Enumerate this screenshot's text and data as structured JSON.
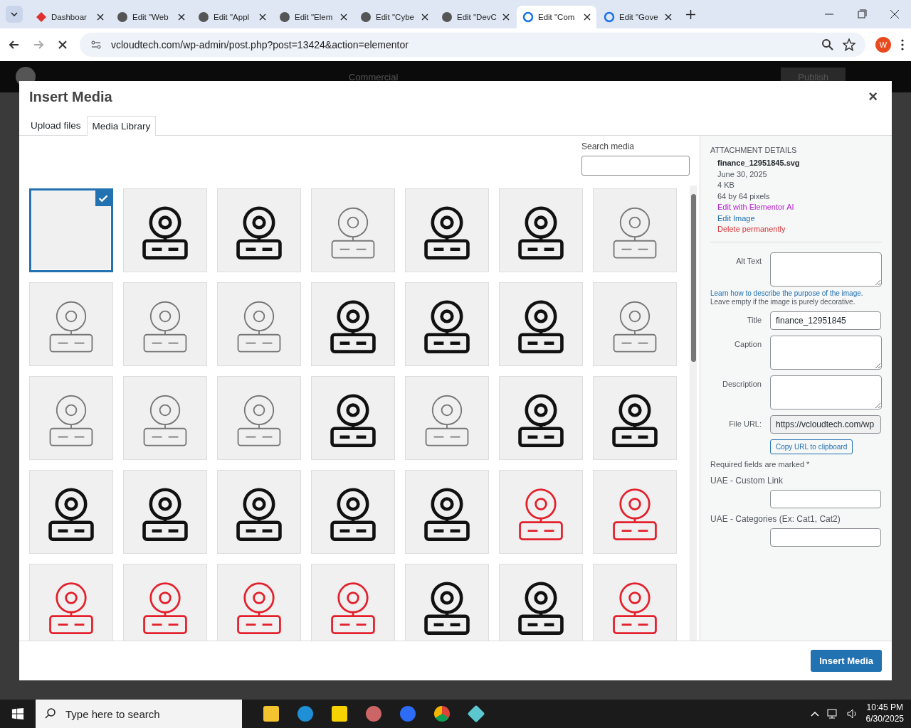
{
  "browser": {
    "tabs": [
      {
        "title": "Dashboar",
        "selected": false,
        "kind": "site"
      },
      {
        "title": "Edit \"Web",
        "selected": false,
        "kind": "globe"
      },
      {
        "title": "Edit \"Appl",
        "selected": false,
        "kind": "globe"
      },
      {
        "title": "Edit \"Elem",
        "selected": false,
        "kind": "globe"
      },
      {
        "title": "Edit \"Cybe",
        "selected": false,
        "kind": "globe"
      },
      {
        "title": "Edit \"DevC",
        "selected": false,
        "kind": "globe"
      },
      {
        "title": "Edit \"Com",
        "selected": true,
        "kind": "loading"
      },
      {
        "title": "Edit \"Gove",
        "selected": false,
        "kind": "loading"
      }
    ],
    "url": "vcloudtech.com/wp-admin/post.php?post=13424&action=elementor",
    "profile": "W"
  },
  "editor": {
    "page_name": "Commercial",
    "publish": "Publish"
  },
  "modal": {
    "title": "Insert Media",
    "close": "×",
    "tabs": [
      {
        "label": "Upload files",
        "selected": false
      },
      {
        "label": "Media Library",
        "selected": true
      }
    ],
    "search_label": "Search media",
    "media": [
      {
        "kind": "blank",
        "selected": true
      },
      {
        "kind": "outline",
        "selected": false
      },
      {
        "kind": "outline",
        "selected": false
      },
      {
        "kind": "light",
        "selected": false
      },
      {
        "kind": "outline",
        "selected": false
      },
      {
        "kind": "outline",
        "selected": false
      },
      {
        "kind": "light",
        "selected": false
      },
      {
        "kind": "light",
        "selected": false
      },
      {
        "kind": "light",
        "selected": false
      },
      {
        "kind": "light",
        "selected": false
      },
      {
        "kind": "outline",
        "selected": false
      },
      {
        "kind": "outline",
        "selected": false
      },
      {
        "kind": "outline",
        "selected": false
      },
      {
        "kind": "light",
        "selected": false
      },
      {
        "kind": "light",
        "selected": false
      },
      {
        "kind": "light",
        "selected": false
      },
      {
        "kind": "light",
        "selected": false
      },
      {
        "kind": "outline",
        "selected": false
      },
      {
        "kind": "light",
        "selected": false
      },
      {
        "kind": "outline",
        "selected": false
      },
      {
        "kind": "outline",
        "selected": false
      },
      {
        "kind": "outline",
        "selected": false
      },
      {
        "kind": "outline",
        "selected": false
      },
      {
        "kind": "outline",
        "selected": false
      },
      {
        "kind": "outline",
        "selected": false
      },
      {
        "kind": "outline",
        "selected": false
      },
      {
        "kind": "red",
        "selected": false
      },
      {
        "kind": "red",
        "selected": false
      },
      {
        "kind": "red",
        "selected": false
      },
      {
        "kind": "red",
        "selected": false
      },
      {
        "kind": "red",
        "selected": false
      },
      {
        "kind": "red",
        "selected": false
      },
      {
        "kind": "outline",
        "selected": false
      },
      {
        "kind": "outline",
        "selected": false
      },
      {
        "kind": "red",
        "selected": false
      }
    ],
    "details": {
      "heading": "ATTACHMENT DETAILS",
      "filename": "finance_12951845.svg",
      "date": "June 30, 2025",
      "size": "4 KB",
      "dimensions": "64 by 64 pixels",
      "links": [
        {
          "text": "Edit with Elementor AI",
          "kind": "ai"
        },
        {
          "text": "Edit Image",
          "kind": "edit"
        },
        {
          "text": "Delete permanently",
          "kind": "delete"
        }
      ]
    },
    "fields": [
      {
        "label": "Alt Text",
        "kind": "textarea"
      },
      {
        "kind": "help",
        "link": "Learn how to describe the purpose of the image",
        "text": ". Leave empty if the image is purely decorative."
      },
      {
        "label": "Title",
        "kind": "input",
        "value": "finance_12951845"
      },
      {
        "label": "Caption",
        "kind": "textarea"
      },
      {
        "label": "Description",
        "kind": "textarea"
      },
      {
        "label": "File URL:",
        "kind": "readonly",
        "value": "https://vcloudtech.com/wp"
      },
      {
        "kind": "button",
        "text": "Copy URL to clipboard"
      },
      {
        "kind": "note",
        "text": "Required fields are marked *"
      },
      {
        "label": "UAE - Custom Link",
        "kind": "stacked"
      },
      {
        "label": "UAE - Categories (Ex: Cat1, Cat2)",
        "kind": "stacked"
      }
    ],
    "insert_button": "Insert Media"
  },
  "taskbar": {
    "search_placeholder": "Type here to search",
    "time": "10:45 PM",
    "date": "6/30/2025"
  }
}
